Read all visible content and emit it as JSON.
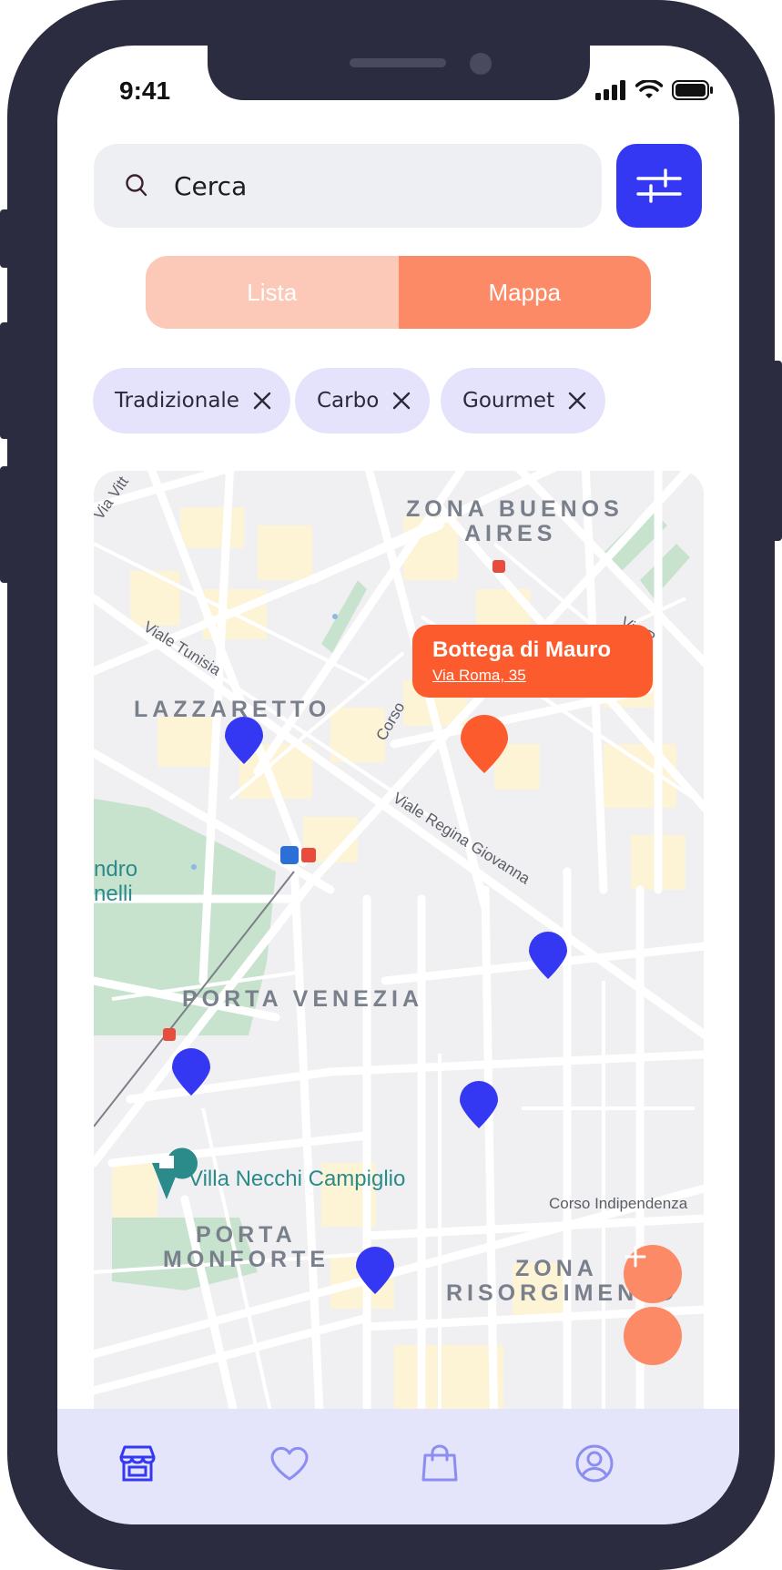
{
  "status_bar": {
    "time": "9:41"
  },
  "search": {
    "placeholder": "Cerca"
  },
  "view_toggle": {
    "lista": "Lista",
    "mappa": "Mappa",
    "active": "mappa"
  },
  "filter_chips": [
    {
      "label": "Tradizionale"
    },
    {
      "label": "Carbo"
    },
    {
      "label": "Gourmet"
    }
  ],
  "map": {
    "area_labels": {
      "zona_buenos_aires_1": "ZONA BUENOS",
      "zona_buenos_aires_2": "AIRES",
      "lazzaretto": "LAZZARETTO",
      "porta_venezia": "PORTA VENEZIA",
      "porta_monforte_1": "PORTA",
      "porta_monforte_2": "MONFORTE",
      "zona_risorgimento_1": "ZONA",
      "zona_risorgimento_2": "RISORGIMENTO"
    },
    "street_labels": {
      "viale_tunisia": "Viale Tunisia",
      "viale_regina_giovanna": "Viale Regina Giovanna",
      "corso_indipendenza": "Corso Indipendenza",
      "corso": "Corso",
      "via_vitt": "Via Vitt",
      "via_p": "Via P"
    },
    "poi_labels": {
      "villa_necchi": "Villa Necchi Campiglio",
      "indro_1": "ndro",
      "indro_2": "nelli"
    },
    "selected_place": {
      "name": "Bottega di Mauro",
      "address": "Via Roma, 35"
    },
    "zoom_in_label": "+"
  },
  "colors": {
    "accent_blue": "#3538f2",
    "accent_orange": "#fc5c2d",
    "toggle_inactive": "#fcc8b8",
    "toggle_active": "#fd8a66",
    "chip_bg": "#e4e3fb",
    "tabbar_bg": "#e4e4fb"
  },
  "tabbar": {
    "items": [
      {
        "icon": "shop-icon",
        "active": true
      },
      {
        "icon": "heart-icon",
        "active": false
      },
      {
        "icon": "shopping-bag-icon",
        "active": false
      },
      {
        "icon": "profile-icon",
        "active": false
      }
    ]
  }
}
